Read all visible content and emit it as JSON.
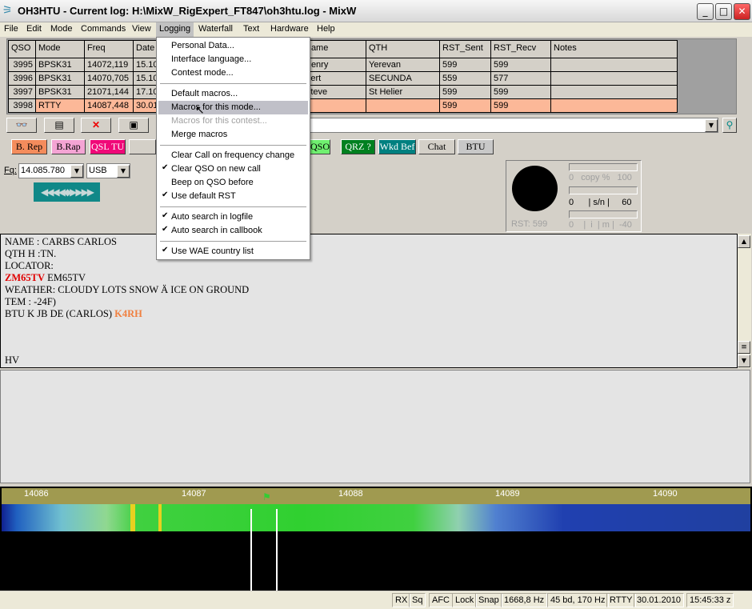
{
  "window": {
    "title": "OH3HTU - Current log: H:\\MixW_RigExpert_FT847\\oh3htu.log - MixW",
    "minimize": "_",
    "maximize": "□",
    "close": "✕"
  },
  "menubar": [
    "File",
    "Edit",
    "Mode",
    "Commands",
    "View",
    "Logging",
    "Waterfall",
    "Text",
    "Hardware",
    "Help"
  ],
  "log": {
    "columns": [
      "QSO",
      "Mode",
      "Freq",
      "Date",
      "Name",
      "QTH",
      "RST_Sent",
      "RST_Recv",
      "Notes"
    ],
    "rows": [
      {
        "qso": "3995",
        "mode": "BPSK31",
        "freq": "14072,119",
        "date": "15.10",
        "name": "Henry",
        "qth": "Yerevan",
        "sent": "599",
        "recv": "599",
        "notes": ""
      },
      {
        "qso": "3996",
        "mode": "BPSK31",
        "freq": "14070,705",
        "date": "15.10",
        "name": "Bert",
        "qth": "SECUNDA",
        "sent": "559",
        "recv": "577",
        "notes": ""
      },
      {
        "qso": "3997",
        "mode": "BPSK31",
        "freq": "21071,144",
        "date": "17.10",
        "name": "Steve",
        "qth": "St Helier",
        "sent": "599",
        "recv": "599",
        "notes": ""
      },
      {
        "qso": "3998",
        "mode": "RTTY",
        "freq": "14087,448",
        "date": "30.01",
        "name": "",
        "qth": "",
        "sent": "599",
        "recv": "599",
        "notes": ""
      }
    ]
  },
  "toolbar": {
    "icons": [
      "glasses-icon",
      "card-icon",
      "delete-icon",
      "save-icon"
    ]
  },
  "macros": {
    "b_rep": "B. Rep",
    "b_rap": "B.Rap",
    "qsl_tu": "QSL TU",
    "qso": "QSO ?",
    "qrz": "QRZ ?",
    "wkd_bef": "Wkd Bef",
    "chat": "Chat",
    "btu": "BTU"
  },
  "freq": {
    "label": "Fq:",
    "value": "14.085.780",
    "mode": "USB",
    "arrows": "◀◀◀◀◆▶▶▶▶"
  },
  "meters": {
    "copy": "0   copy %   100",
    "sn": "0      | s/n |     60",
    "imd": "0    |  i  | m |  -40",
    "rst": "RST: 599"
  },
  "received": {
    "lines": [
      "NAME   : CARBS CARLOS",
      "QTH  H :TN.",
      "LOCATOR:"
    ],
    "call1": "ZM65TV",
    "call1_rest": " EM65TV",
    "lines2": [
      "WEATHER: CLOUDY LOTS SNOW Ä ICE ON GROUND",
      "TEM : -24F)"
    ],
    "btu": "BTU K JB DE (CARLOS) ",
    "call2": "K4RH",
    "last": "HV"
  },
  "waterfall": {
    "scale": [
      "14086",
      "14087",
      "14088",
      "14089",
      "14090"
    ]
  },
  "status": {
    "rx": "RX",
    "sq": "Sq",
    "afc": "AFC",
    "lock": "Lock",
    "snap": "Snap",
    "freq": "1668,8 Hz",
    "baud": "45 bd, 170 Hz",
    "mode": "RTTY",
    "date": "30.01.2010",
    "time": "15:45:33 z"
  },
  "logging_menu": {
    "items": [
      {
        "label": "Personal Data..."
      },
      {
        "label": "Interface language..."
      },
      {
        "label": "Contest mode..."
      },
      {
        "label": "Default macros..."
      },
      {
        "label": "Macros for this mode..."
      },
      {
        "label": "Macros for this contest..."
      },
      {
        "label": "Merge macros"
      },
      {
        "label": "Clear Call on frequency change"
      },
      {
        "label": "Clear QSO on new call",
        "check": "✔"
      },
      {
        "label": "Beep on QSO before"
      },
      {
        "label": "Use default RST",
        "check": "✔"
      },
      {
        "label": "Auto search in logfile",
        "check": "✔"
      },
      {
        "label": "Auto search in callbook",
        "check": "✔"
      },
      {
        "label": "Use WAE country list",
        "check": "✔"
      }
    ]
  },
  "colors": {
    "b_rep": "#f48c5c",
    "b_rap": "#f4a4d4",
    "qsl_tu": "#f00878",
    "qso": "#70f070",
    "qrz": "#008020",
    "wkd_bef": "#008080",
    "selected_row": "#fcb898",
    "call_red": "#e00000",
    "call_orange": "#f08040"
  }
}
